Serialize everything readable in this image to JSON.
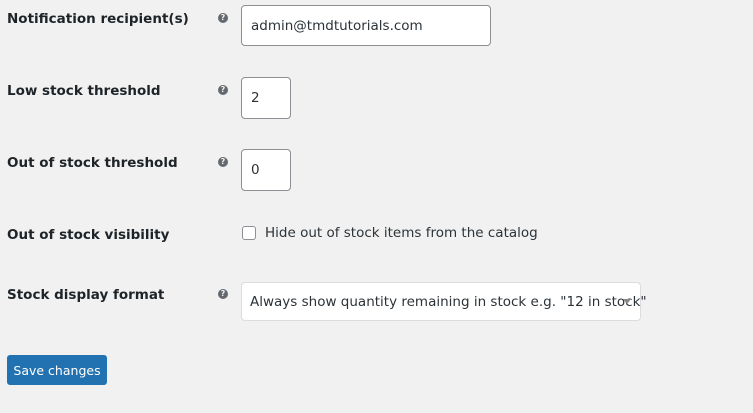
{
  "settings": {
    "notification_recipient": {
      "label": "Notification recipient(s)",
      "value": "admin@tmdtutorials.com"
    },
    "low_stock_threshold": {
      "label": "Low stock threshold",
      "value": "2"
    },
    "out_of_stock_threshold": {
      "label": "Out of stock threshold",
      "value": "0"
    },
    "out_of_stock_visibility": {
      "label": "Out of stock visibility",
      "checkbox_label": "Hide out of stock items from the catalog",
      "checked": false
    },
    "stock_display_format": {
      "label": "Stock display format",
      "selected": "Always show quantity remaining in stock e.g. \"12 in stock\""
    }
  },
  "help_icon_glyph": "?",
  "actions": {
    "save_label": "Save changes"
  },
  "colors": {
    "background": "#f1f1f1",
    "primary_button": "#2271b1"
  }
}
